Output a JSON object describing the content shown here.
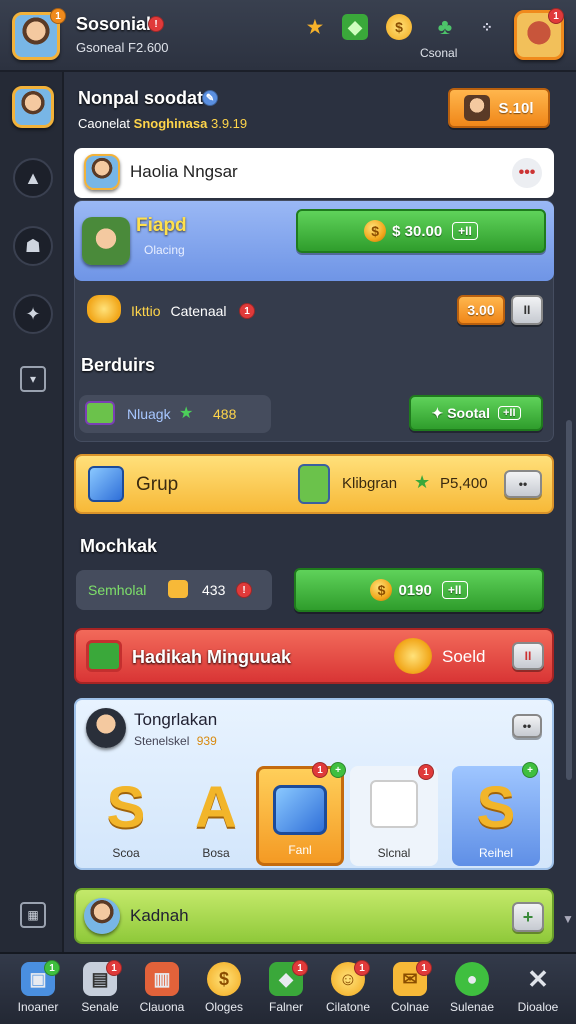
{
  "header": {
    "app_title": "Sosonial",
    "balance": "Gsoneal F2.600",
    "avatar_badge": "1",
    "top_icons": [
      "star-icon",
      "gem-box-icon",
      "coin-icon",
      "clover-icon",
      "menu-dots-icon"
    ],
    "profile_label": "Csonal",
    "profile_badge": "1"
  },
  "profile": {
    "name": "Nonpal soodat",
    "stat_label": "Caonelat",
    "stat_highlight": "Snoghinasa",
    "stat_value": "3.9.19",
    "action_label": "S.10l"
  },
  "player_row": {
    "name": "Haolia Nngsar"
  },
  "featured": {
    "name": "Fiapd",
    "caption": "Olacing",
    "buy_label": "$ 30.00",
    "buy_icon": "+II"
  },
  "reward_row": {
    "label": "Ikttio",
    "label2": "Catenaal",
    "badge": "1",
    "price": "3.00",
    "small": "II"
  },
  "section1": {
    "title": "Berduirs"
  },
  "nuage_row": {
    "label": "Nluagk",
    "value": "488",
    "action": "Sootal",
    "action_icon": "+II"
  },
  "grup": {
    "title": "Grup",
    "item": "Klibgran",
    "price": "P5,400",
    "more": "••"
  },
  "section2": {
    "title": "Mochkak"
  },
  "semhol_row": {
    "label": "Semholal",
    "value": "433",
    "buy": "0190",
    "buy_icon": "+II"
  },
  "red_banner": {
    "title": "Hadikah Minguuak",
    "action": "Soeld",
    "close": "II"
  },
  "tongrlakan": {
    "title": "Tongrlakan",
    "subtitle": "Stenelskel",
    "value": "939",
    "tiles": [
      {
        "label": "Scoa"
      },
      {
        "label": "Bosa"
      },
      {
        "label": "Fanl",
        "badge": "1",
        "badge2": "+"
      },
      {
        "label": "Slcnal",
        "badge": "1"
      },
      {
        "label": "Reihel",
        "badge": "+"
      }
    ]
  },
  "kadnah": {
    "title": "Kadnah",
    "action": "+"
  },
  "bottom_nav": [
    {
      "label": "Inoaner",
      "badge": "1",
      "icon": "box-icon"
    },
    {
      "label": "Senale",
      "badge": "1",
      "icon": "cup-icon"
    },
    {
      "label": "Clauona",
      "icon": "bag-icon"
    },
    {
      "label": "Ologes",
      "icon": "coins-icon"
    },
    {
      "label": "Falner",
      "badge": "1",
      "icon": "gem-icon"
    },
    {
      "label": "Cilatone",
      "badge": "1",
      "icon": "face-icon"
    },
    {
      "label": "Colnae",
      "badge": "1",
      "icon": "mail-icon"
    },
    {
      "label": "Sulenae",
      "icon": "globe-icon"
    },
    {
      "label": "Dioaloe",
      "icon": "close-icon"
    }
  ],
  "colors": {
    "green": "#3fb43b",
    "orange": "#f49a24",
    "blue": "#7fa9f0",
    "yellow": "#ffce4e",
    "red": "#e84343",
    "lime": "#a8d74a"
  }
}
